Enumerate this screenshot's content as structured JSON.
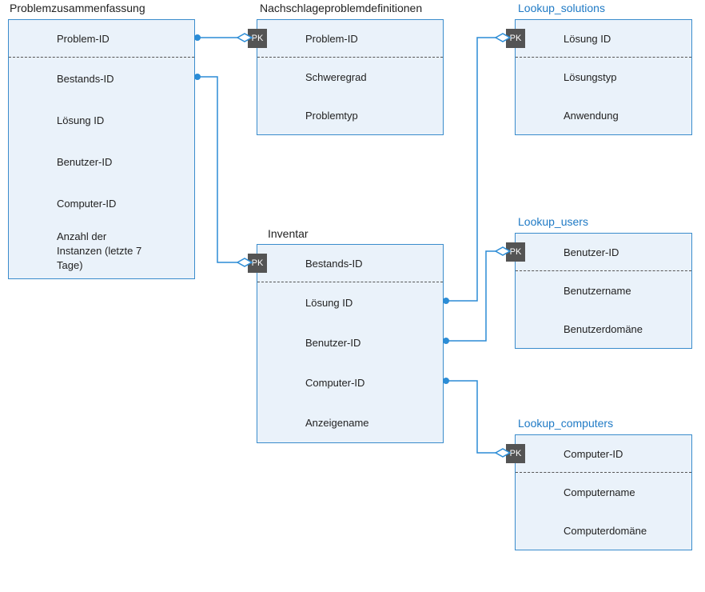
{
  "entities": {
    "problem_summary": {
      "title": "Problemzusammenfassung",
      "fields": {
        "problem_id": "Problem-ID",
        "bestands_id": "Bestands-ID",
        "loesung_id": "Lösung    ID",
        "benutzer_id": "Benutzer-ID",
        "computer_id": "Computer-ID",
        "anzahl": "Anzahl der Instanzen (letzte 7 Tage)"
      }
    },
    "problem_defs": {
      "title": "Nachschlageproblemdefinitionen",
      "fields": {
        "problem_id": "Problem-ID",
        "schweregrad": "Schweregrad",
        "problemtyp": "Problemtyp"
      }
    },
    "lookup_solutions": {
      "title": "Lookup_solutions",
      "fields": {
        "loesung_id": "Lösung    ID",
        "loesungstyp": "Lösungstyp",
        "anwendung": "Anwendung"
      }
    },
    "inventar": {
      "title": "Inventar",
      "fields": {
        "bestands_id": "Bestands-ID",
        "loesung_id": "Lösung    ID",
        "benutzer_id": "Benutzer-ID",
        "computer_id": "Computer-ID",
        "anzeigename": "Anzeigename"
      }
    },
    "lookup_users": {
      "title": "Lookup_users",
      "fields": {
        "benutzer_id": "Benutzer-ID",
        "benutzername": "Benutzername",
        "benutzerdomaene": "Benutzerdomäne"
      }
    },
    "lookup_computers": {
      "title": "Lookup_computers",
      "fields": {
        "computer_id": "Computer-ID",
        "computername": "Computername",
        "computerdomaene": "Computerdomäne"
      }
    }
  },
  "pk_label": "PK"
}
